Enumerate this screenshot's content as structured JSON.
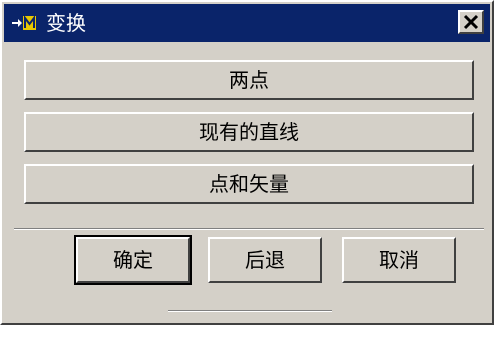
{
  "window": {
    "title": "变换",
    "colors": {
      "titlebar": "#0a246a",
      "face": "#d4d0c8"
    },
    "icons": {
      "app": "app-logo-icon",
      "close": "close-icon"
    }
  },
  "options": [
    {
      "label": "两点"
    },
    {
      "label": "现有的直线"
    },
    {
      "label": "点和矢量"
    }
  ],
  "actions": {
    "ok_label": "确定",
    "back_label": "后退",
    "cancel_label": "取消"
  }
}
